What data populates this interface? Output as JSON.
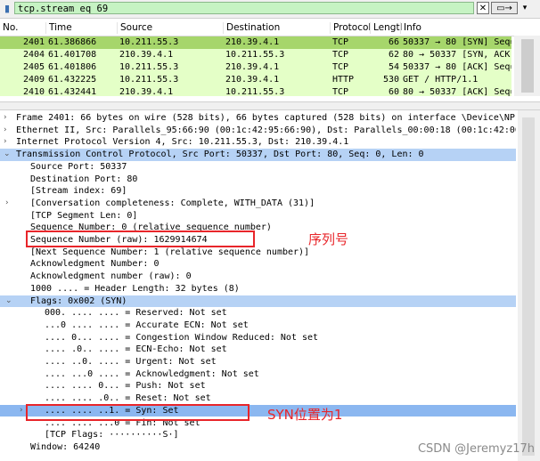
{
  "filter": {
    "value": "tcp.stream eq 69",
    "clear_label": "✕",
    "apply_label": "▭→",
    "dropdown_label": "▾",
    "bookmark_icon": "bookmark-icon"
  },
  "packet_list": {
    "columns": [
      "No.",
      "Time",
      "Source",
      "Destination",
      "Protocol",
      "Lengtl",
      "Info"
    ],
    "rows": [
      {
        "no": "2401",
        "time": "61.386866",
        "src": "10.211.55.3",
        "dst": "210.39.4.1",
        "proto": "TCP",
        "len": "66",
        "info": "50337 → 80 [SYN] Seq=",
        "selected": true
      },
      {
        "no": "2404",
        "time": "61.401708",
        "src": "210.39.4.1",
        "dst": "10.211.55.3",
        "proto": "TCP",
        "len": "62",
        "info": "80 → 50337 [SYN, ACK]",
        "selected": false
      },
      {
        "no": "2405",
        "time": "61.401806",
        "src": "10.211.55.3",
        "dst": "210.39.4.1",
        "proto": "TCP",
        "len": "54",
        "info": "50337 → 80 [ACK] Seq=",
        "selected": false
      },
      {
        "no": "2409",
        "time": "61.432225",
        "src": "10.211.55.3",
        "dst": "210.39.4.1",
        "proto": "HTTP",
        "len": "530",
        "info": "GET / HTTP/1.1",
        "selected": false
      },
      {
        "no": "2410",
        "time": "61.432441",
        "src": "210.39.4.1",
        "dst": "10.211.55.3",
        "proto": "TCP",
        "len": "60",
        "info": "80 → 50337 [ACK] Seq=",
        "selected": false
      }
    ]
  },
  "details": [
    {
      "indent": 0,
      "arrow": "›",
      "text": "Frame 2401: 66 bytes on wire (528 bits), 66 bytes captured (528 bits) on interface \\Device\\NPF_{501"
    },
    {
      "indent": 0,
      "arrow": "›",
      "text": "Ethernet II, Src: Parallels_95:66:90 (00:1c:42:95:66:90), Dst: Parallels_00:00:18 (00:1c:42:00:00:1"
    },
    {
      "indent": 0,
      "arrow": "›",
      "text": "Internet Protocol Version 4, Src: 10.211.55.3, Dst: 210.39.4.1"
    },
    {
      "indent": 0,
      "arrow": "⌄",
      "text": "Transmission Control Protocol, Src Port: 50337, Dst Port: 80, Seq: 0, Len: 0",
      "style": "hl2"
    },
    {
      "indent": 1,
      "arrow": "",
      "text": "Source Port: 50337"
    },
    {
      "indent": 1,
      "arrow": "",
      "text": "Destination Port: 80"
    },
    {
      "indent": 1,
      "arrow": "",
      "text": "[Stream index: 69]"
    },
    {
      "indent": 1,
      "arrow": "›",
      "text": "[Conversation completeness: Complete, WITH_DATA (31)]"
    },
    {
      "indent": 1,
      "arrow": "",
      "text": "[TCP Segment Len: 0]"
    },
    {
      "indent": 1,
      "arrow": "",
      "text": "Sequence Number: 0    (relative sequence number)"
    },
    {
      "indent": 1,
      "arrow": "",
      "text": "Sequence Number (raw): 1629914674"
    },
    {
      "indent": 1,
      "arrow": "",
      "text": "[Next Sequence Number: 1    (relative sequence number)]"
    },
    {
      "indent": 1,
      "arrow": "",
      "text": "Acknowledgment Number: 0"
    },
    {
      "indent": 1,
      "arrow": "",
      "text": "Acknowledgment number (raw): 0"
    },
    {
      "indent": 1,
      "arrow": "",
      "text": "1000 .... = Header Length: 32 bytes (8)"
    },
    {
      "indent": 1,
      "arrow": "⌄",
      "text": "Flags: 0x002 (SYN)",
      "style": "hl2"
    },
    {
      "indent": 2,
      "arrow": "",
      "text": "000. .... .... = Reserved: Not set"
    },
    {
      "indent": 2,
      "arrow": "",
      "text": "...0 .... .... = Accurate ECN: Not set"
    },
    {
      "indent": 2,
      "arrow": "",
      "text": ".... 0... .... = Congestion Window Reduced: Not set"
    },
    {
      "indent": 2,
      "arrow": "",
      "text": ".... .0.. .... = ECN-Echo: Not set"
    },
    {
      "indent": 2,
      "arrow": "",
      "text": ".... ..0. .... = Urgent: Not set"
    },
    {
      "indent": 2,
      "arrow": "",
      "text": ".... ...0 .... = Acknowledgment: Not set"
    },
    {
      "indent": 2,
      "arrow": "",
      "text": ".... .... 0... = Push: Not set"
    },
    {
      "indent": 2,
      "arrow": "",
      "text": ".... .... .0.. = Reset: Not set"
    },
    {
      "indent": 2,
      "arrow": "›",
      "text": ".... .... ..1. = Syn: Set",
      "style": "hl"
    },
    {
      "indent": 2,
      "arrow": "",
      "text": ".... .... ...0 = Fin: Not set"
    },
    {
      "indent": 2,
      "arrow": "",
      "text": "[TCP Flags: ··········S·]"
    },
    {
      "indent": 1,
      "arrow": "",
      "text": "Window: 64240"
    }
  ],
  "annotations": {
    "seq_label": "序列号",
    "syn_label": "SYN位置为1"
  },
  "watermark": "CSDN @Jeremyz17h",
  "colors": {
    "filter_bg": "#c6f3c3",
    "row_bg": "#e4ffc7",
    "row_selected": "#a6d66b",
    "tree_highlight": "#8bb7f0",
    "annotation_red": "#e8252a"
  }
}
